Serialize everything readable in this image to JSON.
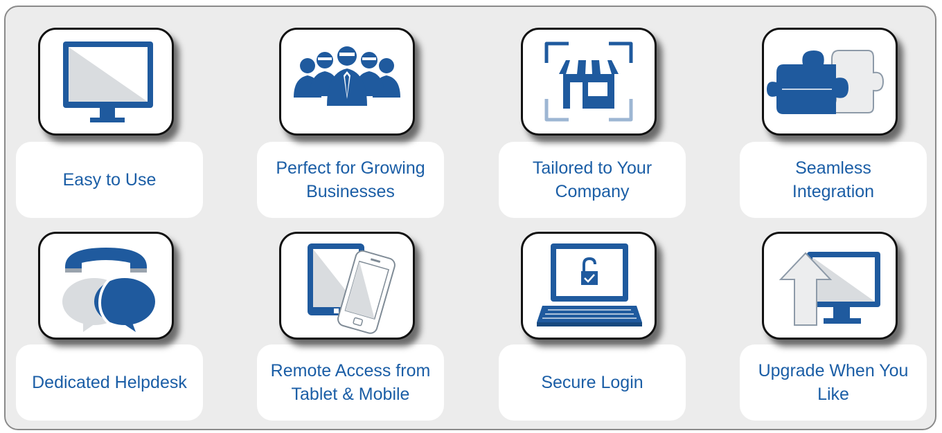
{
  "features": [
    {
      "label": "Easy to Use",
      "icon": "monitor-icon"
    },
    {
      "label": "Perfect for Growing Businesses",
      "icon": "team-icon"
    },
    {
      "label": "Tailored to Your Company",
      "icon": "storefront-icon"
    },
    {
      "label": "Seamless Integration",
      "icon": "puzzle-icon"
    },
    {
      "label": "Dedicated Helpdesk",
      "icon": "phone-chat-icon"
    },
    {
      "label": "Remote Access from Tablet & Mobile",
      "icon": "tablet-mobile-icon"
    },
    {
      "label": "Secure Login",
      "icon": "laptop-lock-icon"
    },
    {
      "label": "Upgrade When You Like",
      "icon": "upgrade-monitor-icon"
    }
  ],
  "colors": {
    "accent": "#1b5ea6",
    "icon_blue": "#1f5a9e",
    "light_gray": "#d9dcdf",
    "panel": "#ececec"
  }
}
